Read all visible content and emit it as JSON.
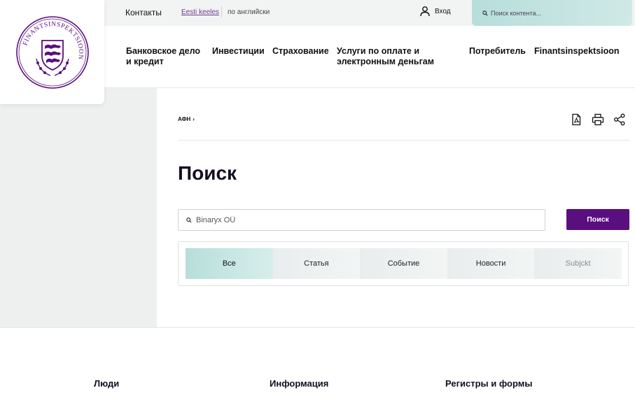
{
  "logo": {
    "text": "FINANTSINSPEKTSIOON",
    "color": "#5a0f7e"
  },
  "topbar": {
    "contacts": "Контакты",
    "lang_current": "Eesti keeles",
    "lang_other": "по английски",
    "login": "Вход",
    "search_placeholder": "Поиск контента..."
  },
  "nav": {
    "items": [
      {
        "label": "Банковское дело и кредит"
      },
      {
        "label": "Инвестиции"
      },
      {
        "label": "Страхование"
      },
      {
        "label": "Услуги по оплате и электронным деньгам"
      },
      {
        "label": "Потребитель"
      },
      {
        "label": "Finantsinspektsioon"
      }
    ]
  },
  "breadcrumb": {
    "root": "АФН",
    "separator": "›"
  },
  "tools": {
    "icons": [
      "pdf-icon",
      "print-icon",
      "share-icon"
    ]
  },
  "main": {
    "title": "Поиск",
    "search_value": "Binaryx OÜ",
    "search_button": "Поиск",
    "tabs": [
      {
        "label": "Все",
        "active": true
      },
      {
        "label": "Статья"
      },
      {
        "label": "Событие"
      },
      {
        "label": "Новости"
      },
      {
        "label": "Subjckt"
      }
    ]
  },
  "footer": {
    "headings": [
      "Люди",
      "Информация",
      "Регистры и формы"
    ]
  },
  "colors": {
    "accent": "#5a0f7e",
    "teal": "#b7dedb",
    "gray_bg": "#eef0f0"
  }
}
